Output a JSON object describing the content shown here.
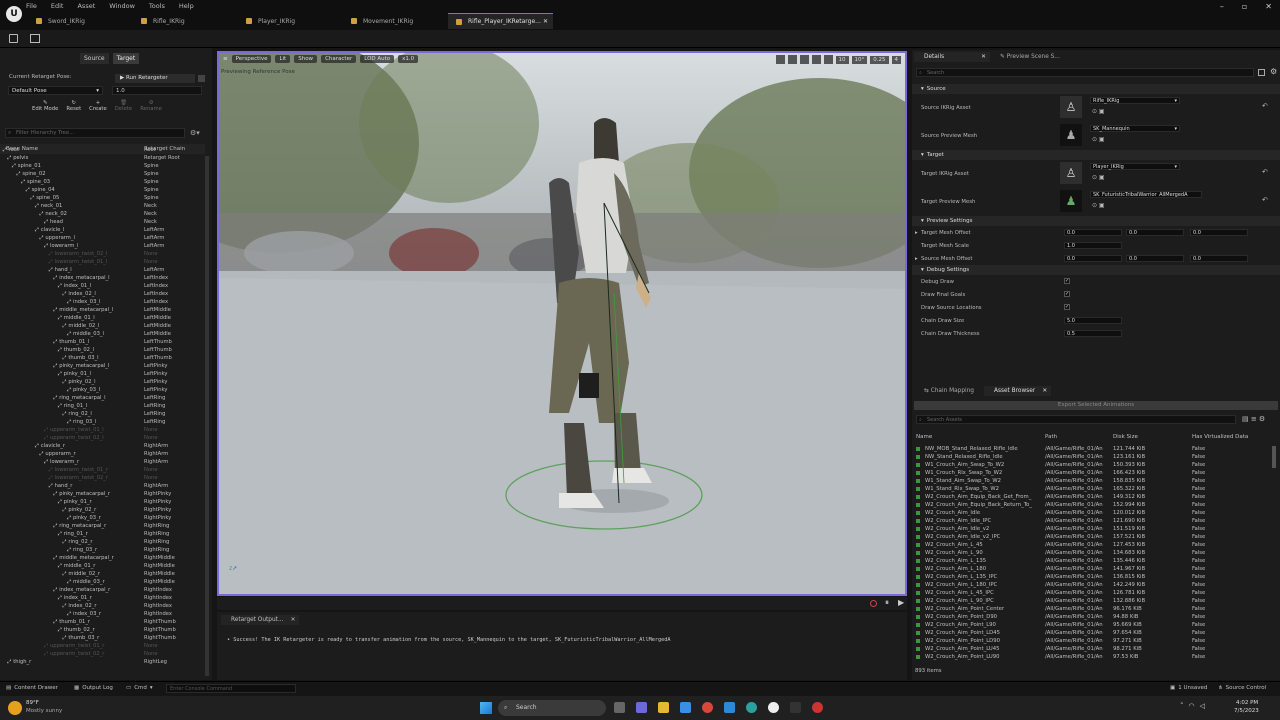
{
  "menu": [
    "File",
    "Edit",
    "Asset",
    "Window",
    "Tools",
    "Help"
  ],
  "tabs": [
    "Sword_IKRig",
    "Rifle_IKRig",
    "Player_IKRig",
    "Movement_IKRig",
    "Rifle_Player_IKRetarge..."
  ],
  "left": {
    "source_tab": "Source",
    "target_tab": "Target",
    "current_pose_label": "Current Retarget Pose:",
    "run_retargeter": "Run Retargeter",
    "pose_value": "Default Pose",
    "pose_number": "1.0",
    "tools": [
      "Edit Mode",
      "Reset",
      "Create",
      "Delete",
      "Rename"
    ],
    "filter_placeholder": "Filter Hierarchy Tree...",
    "col_bone": "Bone Name",
    "col_chain": "Retarget Chain"
  },
  "bones": [
    {
      "n": "root",
      "c": "Root",
      "d": 1,
      "dim": false
    },
    {
      "n": "pelvis",
      "c": "Retarget Root",
      "d": 2,
      "dim": false
    },
    {
      "n": "spine_01",
      "c": "Spine",
      "d": 3,
      "dim": false
    },
    {
      "n": "spine_02",
      "c": "Spine",
      "d": 4,
      "dim": false
    },
    {
      "n": "spine_03",
      "c": "Spine",
      "d": 5,
      "dim": false
    },
    {
      "n": "spine_04",
      "c": "Spine",
      "d": 6,
      "dim": false
    },
    {
      "n": "spine_05",
      "c": "Spine",
      "d": 7,
      "dim": false
    },
    {
      "n": "neck_01",
      "c": "Neck",
      "d": 8,
      "dim": false
    },
    {
      "n": "neck_02",
      "c": "Neck",
      "d": 9,
      "dim": false
    },
    {
      "n": "head",
      "c": "Neck",
      "d": 10,
      "dim": false
    },
    {
      "n": "clavicle_l",
      "c": "LeftArm",
      "d": 8,
      "dim": false
    },
    {
      "n": "upperarm_l",
      "c": "LeftArm",
      "d": 9,
      "dim": false
    },
    {
      "n": "lowerarm_l",
      "c": "LeftArm",
      "d": 10,
      "dim": false
    },
    {
      "n": "lowerarm_twist_02_l",
      "c": "None",
      "d": 11,
      "dim": true
    },
    {
      "n": "lowerarm_twist_01_l",
      "c": "None",
      "d": 11,
      "dim": true
    },
    {
      "n": "hand_l",
      "c": "LeftArm",
      "d": 11,
      "dim": false
    },
    {
      "n": "index_metacarpal_l",
      "c": "LeftIndex",
      "d": 12,
      "dim": false
    },
    {
      "n": "index_01_l",
      "c": "LeftIndex",
      "d": 13,
      "dim": false
    },
    {
      "n": "index_02_l",
      "c": "LeftIndex",
      "d": 14,
      "dim": false
    },
    {
      "n": "index_03_l",
      "c": "LeftIndex",
      "d": 15,
      "dim": false
    },
    {
      "n": "middle_metacarpal_l",
      "c": "LeftMiddle",
      "d": 12,
      "dim": false
    },
    {
      "n": "middle_01_l",
      "c": "LeftMiddle",
      "d": 13,
      "dim": false
    },
    {
      "n": "middle_02_l",
      "c": "LeftMiddle",
      "d": 14,
      "dim": false
    },
    {
      "n": "middle_03_l",
      "c": "LeftMiddle",
      "d": 15,
      "dim": false
    },
    {
      "n": "thumb_01_l",
      "c": "LeftThumb",
      "d": 12,
      "dim": false
    },
    {
      "n": "thumb_02_l",
      "c": "LeftThumb",
      "d": 13,
      "dim": false
    },
    {
      "n": "thumb_03_l",
      "c": "LeftThumb",
      "d": 14,
      "dim": false
    },
    {
      "n": "pinky_metacarpal_l",
      "c": "LeftPinky",
      "d": 12,
      "dim": false
    },
    {
      "n": "pinky_01_l",
      "c": "LeftPinky",
      "d": 13,
      "dim": false
    },
    {
      "n": "pinky_02_l",
      "c": "LeftPinky",
      "d": 14,
      "dim": false
    },
    {
      "n": "pinky_03_l",
      "c": "LeftPinky",
      "d": 15,
      "dim": false
    },
    {
      "n": "ring_metacarpal_l",
      "c": "LeftRing",
      "d": 12,
      "dim": false
    },
    {
      "n": "ring_01_l",
      "c": "LeftRing",
      "d": 13,
      "dim": false
    },
    {
      "n": "ring_02_l",
      "c": "LeftRing",
      "d": 14,
      "dim": false
    },
    {
      "n": "ring_03_l",
      "c": "LeftRing",
      "d": 15,
      "dim": false
    },
    {
      "n": "upperarm_twist_01_l",
      "c": "None",
      "d": 10,
      "dim": true
    },
    {
      "n": "upperarm_twist_02_l",
      "c": "None",
      "d": 10,
      "dim": true
    },
    {
      "n": "clavicle_r",
      "c": "RightArm",
      "d": 8,
      "dim": false
    },
    {
      "n": "upperarm_r",
      "c": "RightArm",
      "d": 9,
      "dim": false
    },
    {
      "n": "lowerarm_r",
      "c": "RightArm",
      "d": 10,
      "dim": false
    },
    {
      "n": "lowerarm_twist_01_r",
      "c": "None",
      "d": 11,
      "dim": true
    },
    {
      "n": "lowerarm_twist_02_r",
      "c": "None",
      "d": 11,
      "dim": true
    },
    {
      "n": "hand_r",
      "c": "RightArm",
      "d": 11,
      "dim": false
    },
    {
      "n": "pinky_metacarpal_r",
      "c": "RightPinky",
      "d": 12,
      "dim": false
    },
    {
      "n": "pinky_01_r",
      "c": "RightPinky",
      "d": 13,
      "dim": false
    },
    {
      "n": "pinky_02_r",
      "c": "RightPinky",
      "d": 14,
      "dim": false
    },
    {
      "n": "pinky_03_r",
      "c": "RightPinky",
      "d": 15,
      "dim": false
    },
    {
      "n": "ring_metacarpal_r",
      "c": "RightRing",
      "d": 12,
      "dim": false
    },
    {
      "n": "ring_01_r",
      "c": "RightRing",
      "d": 13,
      "dim": false
    },
    {
      "n": "ring_02_r",
      "c": "RightRing",
      "d": 14,
      "dim": false
    },
    {
      "n": "ring_03_r",
      "c": "RightRing",
      "d": 15,
      "dim": false
    },
    {
      "n": "middle_metacarpal_r",
      "c": "RightMiddle",
      "d": 12,
      "dim": false
    },
    {
      "n": "middle_01_r",
      "c": "RightMiddle",
      "d": 13,
      "dim": false
    },
    {
      "n": "middle_02_r",
      "c": "RightMiddle",
      "d": 14,
      "dim": false
    },
    {
      "n": "middle_03_r",
      "c": "RightMiddle",
      "d": 15,
      "dim": false
    },
    {
      "n": "index_metacarpal_r",
      "c": "RightIndex",
      "d": 12,
      "dim": false
    },
    {
      "n": "index_01_r",
      "c": "RightIndex",
      "d": 13,
      "dim": false
    },
    {
      "n": "index_02_r",
      "c": "RightIndex",
      "d": 14,
      "dim": false
    },
    {
      "n": "index_03_r",
      "c": "RightIndex",
      "d": 15,
      "dim": false
    },
    {
      "n": "thumb_01_r",
      "c": "RightThumb",
      "d": 12,
      "dim": false
    },
    {
      "n": "thumb_02_r",
      "c": "RightThumb",
      "d": 13,
      "dim": false
    },
    {
      "n": "thumb_03_r",
      "c": "RightThumb",
      "d": 14,
      "dim": false
    },
    {
      "n": "upperarm_twist_01_r",
      "c": "None",
      "d": 10,
      "dim": true
    },
    {
      "n": "upperarm_twist_02_r",
      "c": "None",
      "d": 10,
      "dim": true
    },
    {
      "n": "thigh_r",
      "c": "RightLeg",
      "d": 2,
      "dim": false
    }
  ],
  "viewport": {
    "buttons": [
      "Perspective",
      "Lit",
      "Show",
      "Character",
      "LOD Auto",
      "x1.0"
    ],
    "right_values": [
      "10",
      "10°",
      "0.25",
      "4"
    ],
    "status": "Previewing Reference Pose"
  },
  "output": {
    "tab": "Retarget Output...",
    "message": "• Success! The IK Retargeter is ready to transfer animation from the source, SK_Mannequin to the target, SK_FuturisticTribalWarrior_AllMergedA"
  },
  "details": {
    "tab": "Details",
    "tab2": "Preview Scene S...",
    "search_placeholder": "Search",
    "source_header": "Source",
    "source_ikrig_label": "Source IKRig Asset",
    "source_ikrig_value": "Rifle_IKRig",
    "source_mesh_label": "Source Preview Mesh",
    "source_mesh_value": "SK_Mannequin",
    "target_header": "Target",
    "target_ikrig_label": "Target IKRig Asset",
    "target_ikrig_value": "Player_IKRig",
    "target_mesh_label": "Target Preview Mesh",
    "target_mesh_value": "SK_FuturisticTribalWarrior_AllMergedA",
    "preview_header": "Preview Settings",
    "target_offset_label": "Target Mesh Offset",
    "target_offset": [
      "0.0",
      "0.0",
      "0.0"
    ],
    "target_scale_label": "Target Mesh Scale",
    "target_scale": "1.0",
    "source_offset_label": "Source Mesh Offset",
    "source_offset": [
      "0.0",
      "0.0",
      "0.0"
    ],
    "debug_header": "Debug Settings",
    "debug_draw": "Debug Draw",
    "draw_goals": "Draw Final Goals",
    "draw_source": "Draw Source Locations",
    "chain_size_label": "Chain Draw Size",
    "chain_size": "5.0",
    "chain_thick_label": "Chain Draw Thickness",
    "chain_thick": "0.5"
  },
  "assets": {
    "tab1": "Chain Mapping",
    "tab2": "Asset Browser",
    "export_button": "Export Selected Animations",
    "search_placeholder": "Search Assets",
    "cols": [
      "Name",
      "Path",
      "Disk Size",
      "Has Virtualized Data"
    ],
    "rows": [
      [
        "NW_MOB_Stand_Relaxed_Rifle_Idle",
        "/All/Game/Rifle_01/An",
        "121.744 KiB",
        "False"
      ],
      [
        "NW_Stand_Relaxed_Rifle_Idle",
        "/All/Game/Rifle_01/An",
        "123.161 KiB",
        "False"
      ],
      [
        "W1_Crouch_Aim_Swap_To_W2",
        "/All/Game/Rifle_01/An",
        "150.393 KiB",
        "False"
      ],
      [
        "W1_Crouch_Rlx_Swap_To_W2",
        "/All/Game/Rifle_01/An",
        "166.423 KiB",
        "False"
      ],
      [
        "W1_Stand_Aim_Swap_To_W2",
        "/All/Game/Rifle_01/An",
        "158.835 KiB",
        "False"
      ],
      [
        "W1_Stand_Rlx_Swap_To_W2",
        "/All/Game/Rifle_01/An",
        "165.322 KiB",
        "False"
      ],
      [
        "W2_Crouch_Aim_Equip_Back_Get_From_",
        "/All/Game/Rifle_01/An",
        "149.312 KiB",
        "False"
      ],
      [
        "W2_Crouch_Aim_Equip_Back_Return_To_",
        "/All/Game/Rifle_01/An",
        "152.994 KiB",
        "False"
      ],
      [
        "W2_Crouch_Aim_Idle",
        "/All/Game/Rifle_01/An",
        "120.012 KiB",
        "False"
      ],
      [
        "W2_Crouch_Aim_Idle_IPC",
        "/All/Game/Rifle_01/An",
        "121.690 KiB",
        "False"
      ],
      [
        "W2_Crouch_Aim_Idle_v2",
        "/All/Game/Rifle_01/An",
        "151.519 KiB",
        "False"
      ],
      [
        "W2_Crouch_Aim_Idle_v2_IPC",
        "/All/Game/Rifle_01/An",
        "157.521 KiB",
        "False"
      ],
      [
        "W2_Crouch_Aim_L_45",
        "/All/Game/Rifle_01/An",
        "127.453 KiB",
        "False"
      ],
      [
        "W2_Crouch_Aim_L_90",
        "/All/Game/Rifle_01/An",
        "134.683 KiB",
        "False"
      ],
      [
        "W2_Crouch_Aim_L_135",
        "/All/Game/Rifle_01/An",
        "135.446 KiB",
        "False"
      ],
      [
        "W2_Crouch_Aim_L_180",
        "/All/Game/Rifle_01/An",
        "141.967 KiB",
        "False"
      ],
      [
        "W2_Crouch_Aim_L_135_IPC",
        "/All/Game/Rifle_01/An",
        "136.815 KiB",
        "False"
      ],
      [
        "W2_Crouch_Aim_L_180_IPC",
        "/All/Game/Rifle_01/An",
        "142.249 KiB",
        "False"
      ],
      [
        "W2_Crouch_Aim_L_45_IPC",
        "/All/Game/Rifle_01/An",
        "126.781 KiB",
        "False"
      ],
      [
        "W2_Crouch_Aim_L_90_IPC",
        "/All/Game/Rifle_01/An",
        "132.886 KiB",
        "False"
      ],
      [
        "W2_Crouch_Aim_Point_Center",
        "/All/Game/Rifle_01/An",
        "96.176 KiB",
        "False"
      ],
      [
        "W2_Crouch_Aim_Point_D90",
        "/All/Game/Rifle_01/An",
        "94.88 KiB",
        "False"
      ],
      [
        "W2_Crouch_Aim_Point_L90",
        "/All/Game/Rifle_01/An",
        "95.669 KiB",
        "False"
      ],
      [
        "W2_Crouch_Aim_Point_LD45",
        "/All/Game/Rifle_01/An",
        "97.654 KiB",
        "False"
      ],
      [
        "W2_Crouch_Aim_Point_LD90",
        "/All/Game/Rifle_01/An",
        "97.271 KiB",
        "False"
      ],
      [
        "W2_Crouch_Aim_Point_LU45",
        "/All/Game/Rifle_01/An",
        "98.271 KiB",
        "False"
      ],
      [
        "W2_Crouch_Aim_Point_LU90",
        "/All/Game/Rifle_01/An",
        "97.53 KiB",
        "False"
      ]
    ],
    "count": "893 items"
  },
  "status": {
    "content_drawer": "Content Drawer",
    "output_log": "Output Log",
    "cmd": "Cmd",
    "console_placeholder": "Enter Console Command",
    "unsaved": "1 Unsaved",
    "source_control": "Source Control"
  },
  "taskbar": {
    "weather_temp": "89°F",
    "weather_desc": "Mostly sunny",
    "search": "Search",
    "time": "4:02 PM",
    "date": "7/5/2023"
  }
}
